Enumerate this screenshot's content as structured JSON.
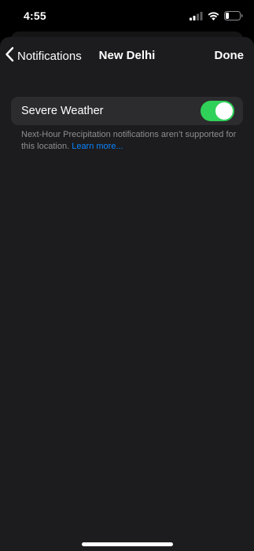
{
  "status_bar": {
    "time": "4:55",
    "icons": [
      "cellular-signal-icon",
      "wifi-icon",
      "battery-icon"
    ]
  },
  "nav": {
    "back_label": "Notifications",
    "title": "New Delhi",
    "done_label": "Done"
  },
  "toggle": {
    "label": "Severe Weather",
    "on": true,
    "on_color": "#30d158"
  },
  "footer": {
    "note": "Next-Hour Precipitation notifications aren’t supported for this location. ",
    "link": "Learn more..."
  },
  "colors": {
    "background": "#000000",
    "sheet": "#1c1c1e",
    "row": "#2c2c2e",
    "secondary_text": "#8e8e93",
    "link": "#0a84ff"
  }
}
